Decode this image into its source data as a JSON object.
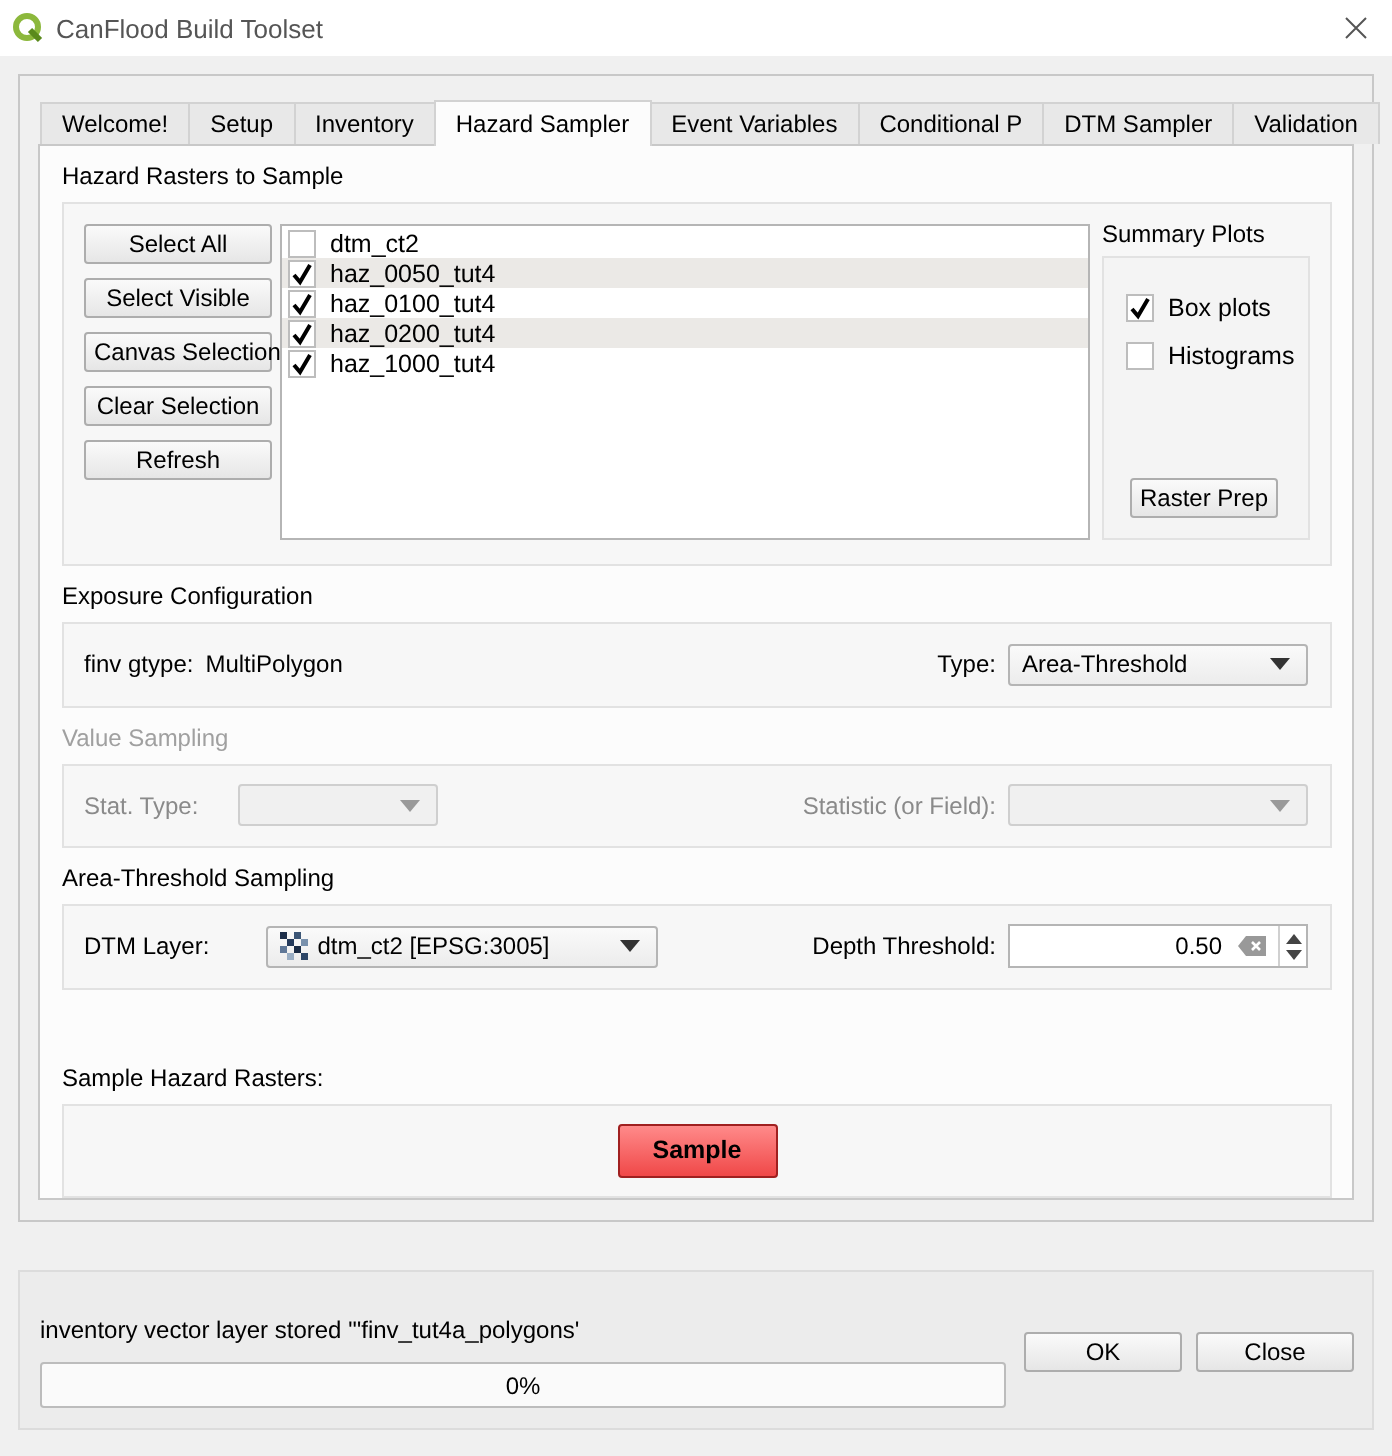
{
  "window": {
    "title": "CanFlood Build Toolset"
  },
  "tabs": [
    {
      "label": "Welcome!",
      "selected": false
    },
    {
      "label": "Setup",
      "selected": false
    },
    {
      "label": "Inventory",
      "selected": false
    },
    {
      "label": "Hazard Sampler",
      "selected": true
    },
    {
      "label": "Event Variables",
      "selected": false
    },
    {
      "label": "Conditional P",
      "selected": false
    },
    {
      "label": "DTM Sampler",
      "selected": false
    },
    {
      "label": "Validation",
      "selected": false
    }
  ],
  "hazard_rasters": {
    "title": "Hazard Rasters to Sample",
    "buttons": [
      "Select All",
      "Select Visible",
      "Canvas Selection",
      "Clear Selection",
      "Refresh"
    ],
    "layers": [
      {
        "name": "dtm_ct2",
        "checked": false
      },
      {
        "name": "haz_0050_tut4",
        "checked": true
      },
      {
        "name": "haz_0100_tut4",
        "checked": true
      },
      {
        "name": "haz_0200_tut4",
        "checked": true
      },
      {
        "name": "haz_1000_tut4",
        "checked": true
      }
    ],
    "summary_plots": {
      "title": "Summary Plots",
      "options": [
        {
          "label": "Box plots",
          "checked": true
        },
        {
          "label": "Histograms",
          "checked": false
        }
      ],
      "button": "Raster Prep"
    }
  },
  "exposure": {
    "title": "Exposure Configuration",
    "gtype_label": "finv gtype:",
    "gtype_value": "MultiPolygon",
    "type_label": "Type:",
    "type_value": "Area-Threshold"
  },
  "value_sampling": {
    "title": "Value Sampling",
    "disabled": true,
    "stat_type_label": "Stat. Type:",
    "statistic_label": "Statistic (or Field):"
  },
  "area_threshold": {
    "title": "Area-Threshold Sampling",
    "dtm_label": "DTM Layer:",
    "dtm_value": "dtm_ct2 [EPSG:3005]",
    "depth_label": "Depth Threshold:",
    "depth_value": "0.50"
  },
  "sample": {
    "title": "Sample Hazard Rasters:",
    "button": "Sample"
  },
  "status": {
    "message": "inventory vector layer stored \"'finv_tut4a_polygons'",
    "progress": {
      "level": 0,
      "text": "0%"
    },
    "buttons": [
      "OK",
      "Close"
    ]
  }
}
